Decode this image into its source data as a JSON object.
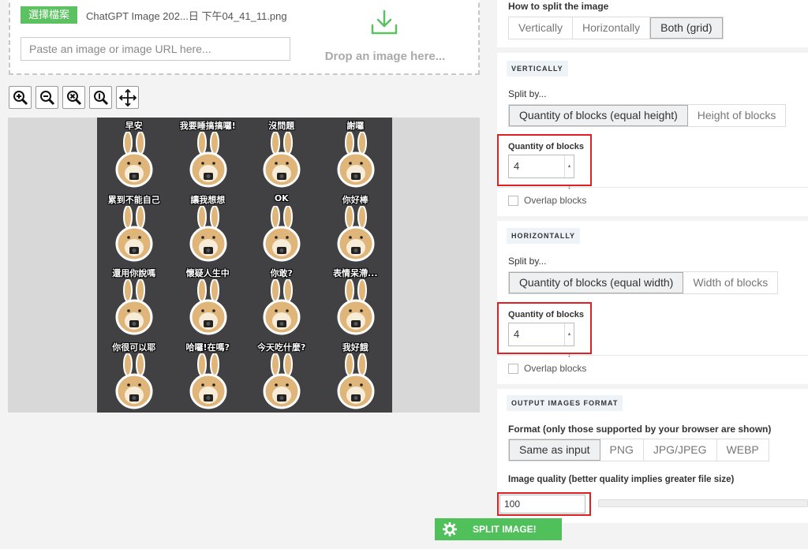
{
  "upload": {
    "file_button": "選擇檔案",
    "file_name": "ChatGPT Image 202...日 下午04_41_11.png",
    "url_placeholder": "Paste an image or image URL here...",
    "drop_text": "Drop an image here..."
  },
  "toolbar": {
    "tools": [
      "zoom-in-icon",
      "zoom-out-icon",
      "zoom-reset-icon",
      "zoom-fit-icon",
      "move-icon"
    ]
  },
  "preview": {
    "stickers": [
      "早安",
      "我要睡搞搞囉!",
      "沒問題",
      "謝囉",
      "累到不能自己",
      "讓我想想",
      "OK",
      "你好棒",
      "還用你說嗎",
      "懷疑人生中",
      "你敢?",
      "表情呆滯...",
      "你很可以耶",
      "哈囉!在嗎?",
      "今天吃什麼?",
      "我好餓"
    ]
  },
  "split": {
    "how_label": "How to split the image",
    "modes": [
      "Vertically",
      "Horizontally",
      "Both (grid)"
    ],
    "active_mode": "Both (grid)"
  },
  "vertically": {
    "title": "VERTICALLY",
    "split_by_label": "Split by...",
    "options": [
      "Quantity of blocks (equal height)",
      "Height of blocks"
    ],
    "quantity_label": "Quantity of blocks",
    "quantity_value": "4",
    "overlap_label": "Overlap blocks"
  },
  "horizontally": {
    "title": "HORIZONTALLY",
    "split_by_label": "Split by...",
    "options": [
      "Quantity of blocks (equal width)",
      "Width of blocks"
    ],
    "quantity_label": "Quantity of blocks",
    "quantity_value": "4",
    "overlap_label": "Overlap blocks"
  },
  "output": {
    "title": "OUTPUT IMAGES FORMAT",
    "format_label": "Format (only those supported by your browser are shown)",
    "formats": [
      "Same as input",
      "PNG",
      "JPG/JPEG",
      "WEBP"
    ],
    "quality_label": "Image quality (better quality implies greater file size)",
    "quality_value": "100"
  },
  "action": {
    "split_button": "SPLIT IMAGE!"
  },
  "colors": {
    "accent_green": "#5cc161",
    "highlight_red": "#e02020",
    "canvas_bg": "#414143",
    "bunny": "#e0b57a"
  }
}
